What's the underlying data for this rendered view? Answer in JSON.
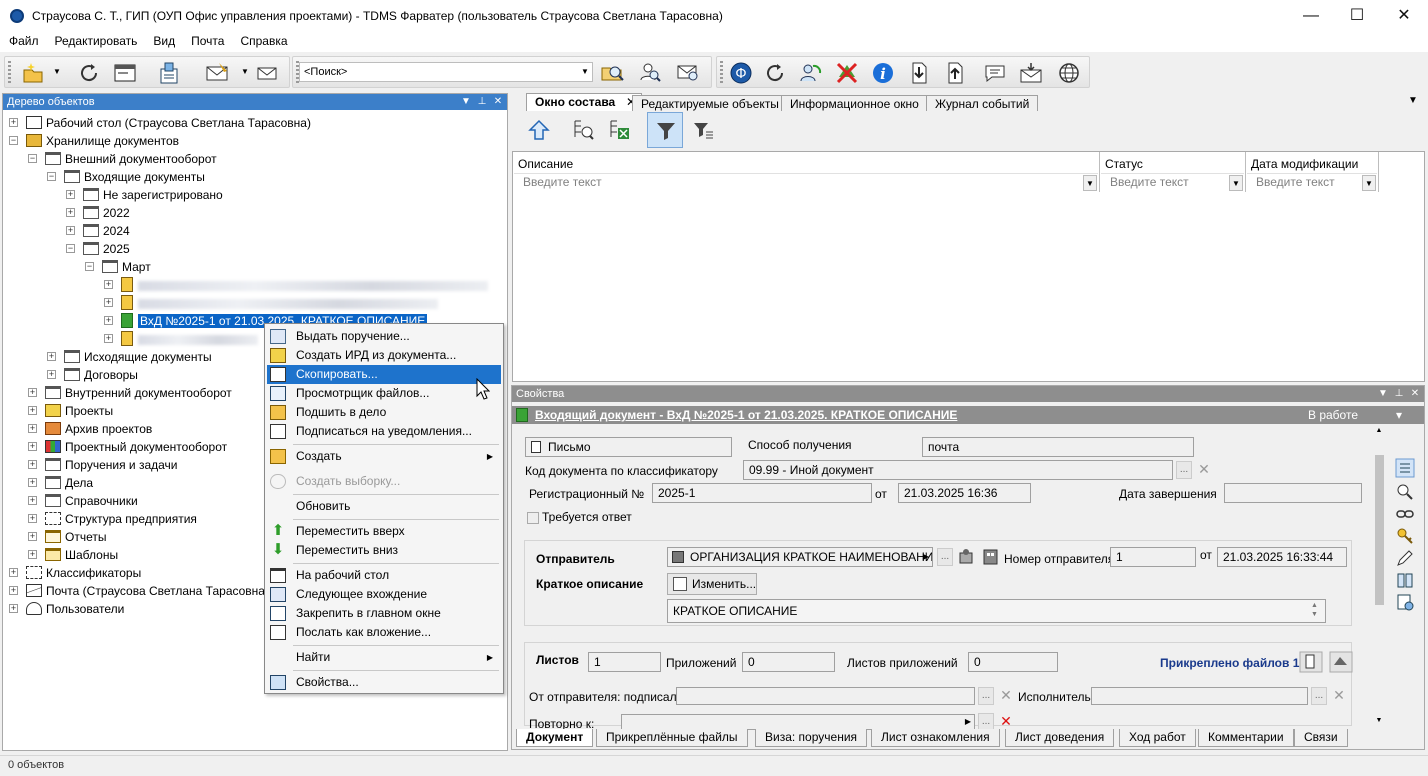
{
  "window": {
    "title": "Страусова С. Т., ГИП (ОУП Офис управления проектами) - TDMS Фарватер (пользователь Страусова Светлана Тарасовна)",
    "minimize": "—",
    "maximize": "☐",
    "close": "✕"
  },
  "menu": [
    "Файл",
    "Редактировать",
    "Вид",
    "Почта",
    "Справка"
  ],
  "toolbar": {
    "search_value": "<Поиск>"
  },
  "left_panel": {
    "header": "Дерево объектов",
    "tree": {
      "desktop": "Рабочий стол (Страусова Светлана Тарасовна)",
      "storage": "Хранилище документов",
      "external": "Внешний документооборот",
      "incoming": "Входящие документы",
      "unregistered": "Не зарегистрировано",
      "y2022": "2022",
      "y2024": "2024",
      "y2025": "2025",
      "march": "Март",
      "selected_doc": "ВхД №2025-1 от 21.03.2025. КРАТКОЕ ОПИСАНИЕ",
      "outgoing": "Исходящие документы",
      "contracts": "Договоры",
      "internal": "Внутренний документооборот",
      "projects": "Проекты",
      "projects_archive": "Архив проектов",
      "project_docflow": "Проектный документооборот",
      "tasks": "Поручения и задачи",
      "cases": "Дела",
      "refs": "Справочники",
      "structure": "Структура предприятия",
      "reports": "Отчеты",
      "templates": "Шаблоны",
      "classifiers": "Классификаторы",
      "mail": "Почта (Страусова Светлана Тарасовна)",
      "users": "Пользователи"
    }
  },
  "context_menu": {
    "issue_task": "Выдать поручение...",
    "create_ird": "Создать ИРД из документа...",
    "copy": "Скопировать...",
    "file_viewer": "Просмотрщик файлов...",
    "file_to_case": "Подшить в дело",
    "subscribe": "Подписаться на уведомления...",
    "create": "Создать",
    "create_selection": "Создать выборку...",
    "refresh": "Обновить",
    "move_up": "Переместить вверх",
    "move_down": "Переместить вниз",
    "to_desktop": "На рабочий стол",
    "next_entry": "Следующее вхождение",
    "pin_main": "Закрепить в главном окне",
    "send_attachment": "Послать как вложение...",
    "find": "Найти",
    "properties": "Свойства..."
  },
  "top_tabs": [
    "Окно состава",
    "Редактируемые объекты",
    "Информационное окно",
    "Журнал событий"
  ],
  "grid": {
    "columns": [
      {
        "label": "Описание",
        "placeholder": "Введите текст"
      },
      {
        "label": "Статус",
        "placeholder": "Введите текст"
      },
      {
        "label": "Дата модификации",
        "placeholder": "Введите текст"
      }
    ]
  },
  "properties": {
    "header": "Свойства",
    "object_title": "Входящий документ - ВхД №2025-1 от 21.03.2025. КРАТКОЕ ОПИСАНИЕ",
    "state": "В работе",
    "doc_kind": "Письмо",
    "receive_method_label": "Способ получения",
    "receive_method": "почта",
    "classifier_label": "Код документа по классификатору",
    "classifier": "09.99 - Иной документ",
    "reg_label": "Регистрационный  №",
    "reg_no": "2025-1",
    "from_label": "от",
    "reg_date": "21.03.2025 16:36",
    "end_date_label": "Дата завершения",
    "end_date": "",
    "reply_required": "Требуется ответ",
    "sender_label": "Отправитель",
    "sender": "ОРГАНИЗАЦИЯ КРАТКОЕ НАИМЕНОВАНИЕ",
    "sender_no_label": "Номер отправителя",
    "sender_no": "1",
    "sender_from_label": "от",
    "sender_date": "21.03.2025 16:33:44",
    "short_desc_label": "Краткое описание",
    "edit_button": "Изменить...",
    "short_desc": "КРАТКОЕ ОПИСАНИЕ",
    "sheets_label": "Листов",
    "sheets": "1",
    "attachments_label": "Приложений",
    "attachments": "0",
    "att_sheets_label": "Листов приложений",
    "att_sheets": "0",
    "attached_files": "Прикреплено файлов 1",
    "signed_label": "От отправителя: подписал",
    "executor_label": "Исполнитель",
    "repeat_label": "Повторно к:"
  },
  "bottom_tabs": [
    "Документ",
    "Прикреплённые файлы",
    "Виза: поручения",
    "Лист ознакомления",
    "Лист доведения",
    "Ход работ",
    "Комментарии",
    "Связи"
  ],
  "status": "0 объектов"
}
